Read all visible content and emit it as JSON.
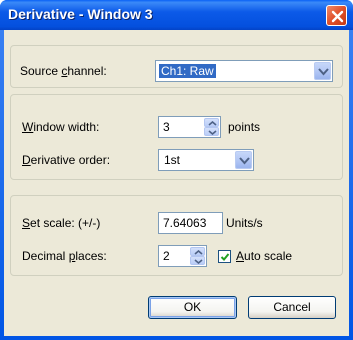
{
  "window": {
    "title": "Derivative - Window 3"
  },
  "source_channel": {
    "label_pre": "Source ",
    "label_u": "c",
    "label_post": "hannel:",
    "value": "Ch1: Raw"
  },
  "window_width": {
    "label_u": "W",
    "label_post": "indow width:",
    "value": "3",
    "unit": "points"
  },
  "derivative_order": {
    "label_u": "D",
    "label_post": "erivative order:",
    "value": "1st"
  },
  "set_scale": {
    "label_u": "S",
    "label_post": "et scale: (+/-)",
    "value": "7.64063",
    "unit": "Units/s"
  },
  "decimal_places": {
    "label_pre": "Decimal ",
    "label_u": "p",
    "label_post": "laces:",
    "value": "2"
  },
  "auto_scale": {
    "label_u": "A",
    "label_post": "uto scale",
    "checked": true
  },
  "buttons": {
    "ok": "OK",
    "cancel": "Cancel"
  },
  "colors": {
    "titlebar": "#0054e3",
    "dialog_bg": "#ece9d8",
    "selection": "#316ac5",
    "close_button": "#e0502a"
  }
}
